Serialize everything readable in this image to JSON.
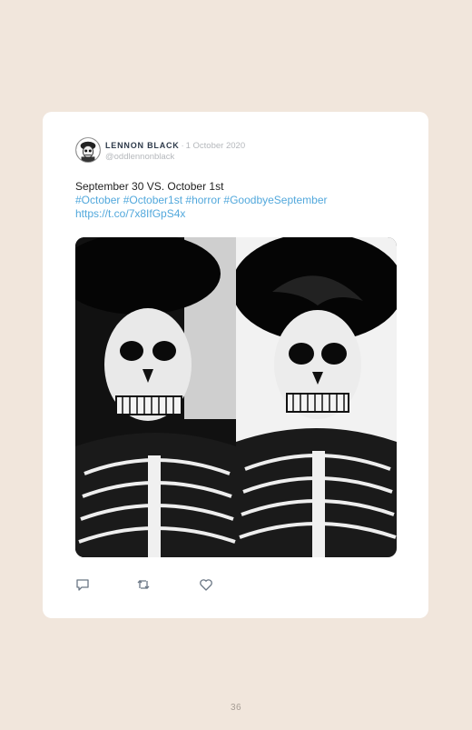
{
  "tweet": {
    "author_name": "LENNON BLACK",
    "separator": "·",
    "date": "1 October 2020",
    "handle": "@oddlennonblack",
    "text": "September 30 VS. October 1st",
    "hashtags": "#October #October1st #horror #GoodbyeSeptember",
    "link": "https://t.co/7x8IfGpS4x"
  },
  "media": {
    "left_photo": "skeleton-makeup-photo",
    "right_photo": "skeleton-makeup-photo"
  },
  "actions": {
    "reply_icon": "reply-icon",
    "retweet_icon": "retweet-icon",
    "like_icon": "heart-icon"
  },
  "page": {
    "number": "36"
  },
  "colors": {
    "background": "#f1e6dc",
    "card": "#ffffff",
    "link": "#52a8dc",
    "muted": "#b5b8bc"
  }
}
